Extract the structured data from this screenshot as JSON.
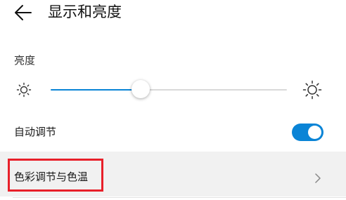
{
  "header": {
    "title": "显示和亮度",
    "back_icon": "arrow-left-icon"
  },
  "brightness": {
    "section_label": "亮度",
    "level_fraction": 0.38,
    "low_icon": "sun-low-icon",
    "high_icon": "sun-high-icon",
    "accent_color": "#0a84d6"
  },
  "auto_adjust": {
    "label": "自动调节",
    "enabled": true,
    "toggle_color": "#0a84d6"
  },
  "color_adjust": {
    "label": "色彩调节与色温",
    "chevron_icon": "chevron-right-icon",
    "highlight_color": "#e8202a"
  }
}
